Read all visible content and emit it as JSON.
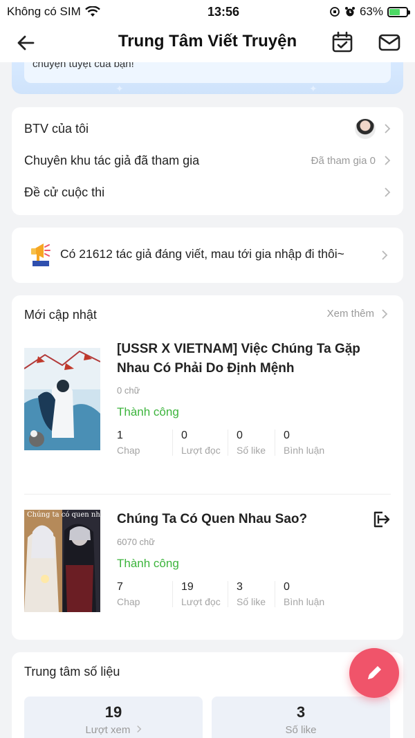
{
  "status_bar": {
    "carrier": "Không có SIM",
    "time": "13:56",
    "battery_percent": "63%",
    "battery_level": 0.63
  },
  "nav": {
    "title": "Trung Tâm Viết Truyện"
  },
  "banner": {
    "text": "chuyện tuyệt của bạn!"
  },
  "menu": {
    "items": [
      {
        "label": "BTV của tôi",
        "right": ""
      },
      {
        "label": "Chuyên khu tác giả đã tham gia",
        "right": "Đã tham gia 0"
      },
      {
        "label": "Đề cử cuộc thi",
        "right": ""
      }
    ]
  },
  "announce": {
    "text": "Có 21612 tác giả đáng viết, mau tới gia nhập đi thôi~"
  },
  "updates": {
    "title": "Mới cập nhật",
    "more": "Xem thêm",
    "books": [
      {
        "title": "[USSR X VIETNAM] Việc Chúng Ta Gặp Nhau Có Phải Do Định Mệnh",
        "words": "0 chữ",
        "status": "Thành công",
        "stats": [
          {
            "value": "1",
            "label": "Chap"
          },
          {
            "value": "0",
            "label": "Lượt đọc"
          },
          {
            "value": "0",
            "label": "Số like"
          },
          {
            "value": "0",
            "label": "Bình luận"
          }
        ]
      },
      {
        "title": "Chúng Ta Có Quen Nhau Sao?",
        "cover_text": "Chúng ta có quen nhau sao?",
        "words": "6070 chữ",
        "status": "Thành công",
        "stats": [
          {
            "value": "7",
            "label": "Chap"
          },
          {
            "value": "19",
            "label": "Lượt đọc"
          },
          {
            "value": "3",
            "label": "Số like"
          },
          {
            "value": "0",
            "label": "Bình luận"
          }
        ]
      }
    ]
  },
  "data_center": {
    "title": "Trung tâm số liệu",
    "tiles": [
      {
        "value": "19",
        "label": "Lượt xem"
      },
      {
        "value": "3",
        "label": "Số like"
      }
    ]
  },
  "colors": {
    "status_success": "#3cb43c",
    "fab": "#f0546a",
    "banner": "#d7e9ff"
  }
}
